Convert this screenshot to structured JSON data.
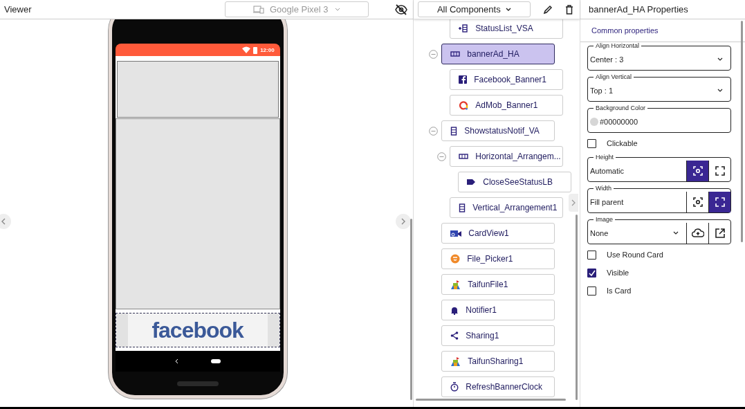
{
  "viewer": {
    "title": "Viewer",
    "device": {
      "label": "Google Pixel 3",
      "disabled": true
    },
    "phone": {
      "time": "12:00",
      "banner_text": "facebook"
    }
  },
  "components": {
    "filter": "All Components",
    "scrolled_children": [
      {
        "label": "StatusList_VSA",
        "kind": "vsa",
        "selected": false
      }
    ],
    "items": [
      {
        "label": "bannerAd_HA",
        "kind": "harr",
        "selected": true,
        "expanded": true,
        "children": [
          {
            "label": "Facebook_Banner1",
            "kind": "fb",
            "selected": false
          },
          {
            "label": "AdMob_Banner1",
            "kind": "admob",
            "selected": false
          }
        ]
      },
      {
        "label": "ShowstatusNotif_VA",
        "kind": "varr",
        "selected": false,
        "expanded": true,
        "children": [
          {
            "label": "Horizontal_Arrangem...",
            "kind": "harr",
            "selected": false,
            "expanded": true,
            "children": [
              {
                "label": "CloseSeeStatusLB",
                "kind": "label",
                "selected": false
              }
            ]
          },
          {
            "label": "Vertical_Arrangement1",
            "kind": "varr",
            "selected": false
          }
        ]
      },
      {
        "label": "CardView1",
        "kind": "card",
        "selected": false
      },
      {
        "label": "File_Picker1",
        "kind": "picker",
        "selected": false
      },
      {
        "label": "TaifunFile1",
        "kind": "ext",
        "selected": false
      },
      {
        "label": "Notifier1",
        "kind": "bell",
        "selected": false
      },
      {
        "label": "Sharing1",
        "kind": "share",
        "selected": false
      },
      {
        "label": "TaifunSharing1",
        "kind": "ext",
        "selected": false
      },
      {
        "label": "RefreshBannerClock",
        "kind": "clock",
        "selected": false
      }
    ]
  },
  "properties": {
    "title": "bannerAd_HA Properties",
    "section": "Common properties",
    "items": [
      {
        "kind": "select",
        "label": "Align Horizontal",
        "value": "Center : 3"
      },
      {
        "kind": "select",
        "label": "Align Vertical",
        "value": "Top : 1"
      },
      {
        "kind": "color",
        "label": "Background Color",
        "value": "#00000000"
      },
      {
        "kind": "checkbox",
        "label": "Clickable",
        "checked": false
      },
      {
        "kind": "size",
        "label": "Height",
        "value": "Automatic",
        "options": [
          {
            "kind": "automatic",
            "selected": true
          },
          {
            "kind": "fill",
            "selected": false
          }
        ]
      },
      {
        "kind": "size",
        "label": "Width",
        "value": "Fill parent",
        "options": [
          {
            "kind": "automatic",
            "selected": false
          },
          {
            "kind": "fill",
            "selected": true
          }
        ]
      },
      {
        "kind": "image",
        "label": "Image",
        "value": "None"
      },
      {
        "kind": "checkbox",
        "label": "Use Round Card",
        "checked": false
      },
      {
        "kind": "checkbox",
        "label": "Visible",
        "checked": true
      },
      {
        "kind": "checkbox",
        "label": "Is Card",
        "checked": false
      }
    ]
  }
}
